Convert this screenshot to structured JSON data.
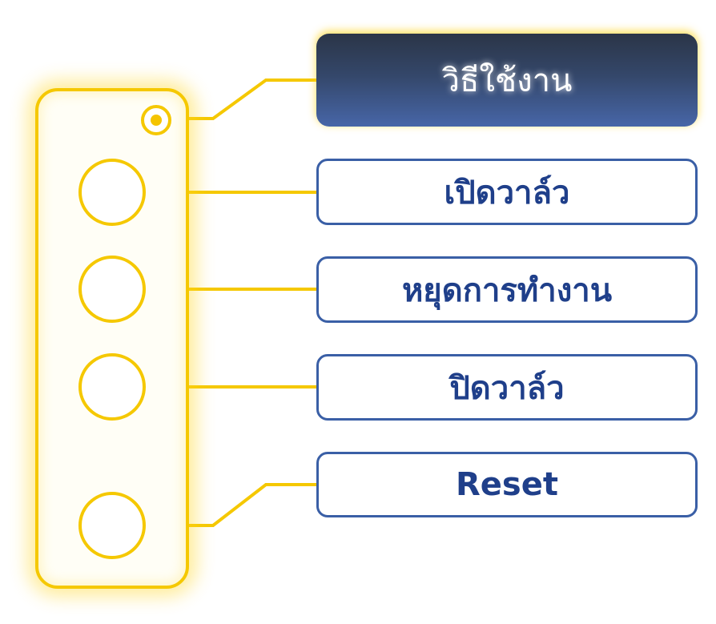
{
  "header": {
    "title": "วิธีใช้งาน"
  },
  "buttons": [
    {
      "label": "เปิดวาล์ว"
    },
    {
      "label": "หยุดการทำงาน"
    },
    {
      "label": "ปิดวาล์ว"
    },
    {
      "label": "Reset"
    }
  ],
  "colors": {
    "accent_yellow": "#f5c800",
    "label_border": "#3a5fa6",
    "label_text": "#1f3f8a",
    "header_gradient_top": "#2b3547",
    "header_gradient_bottom": "#4766a8"
  }
}
